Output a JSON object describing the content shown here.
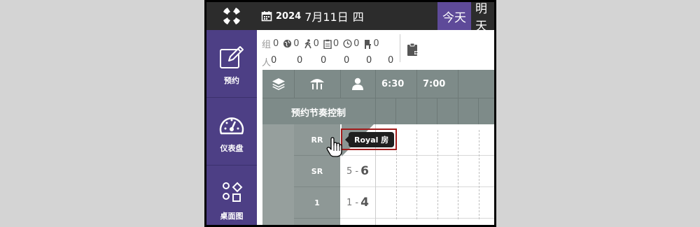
{
  "topbar": {
    "year": "2024",
    "month_day": "7月11日",
    "weekday": "四",
    "today_label": "今天",
    "tomorrow_label": "明天"
  },
  "sidebar": {
    "items": [
      {
        "label": "预约",
        "icon": "edit-icon"
      },
      {
        "label": "仪表盘",
        "icon": "dashboard-gauge-icon"
      },
      {
        "label": "桌面图",
        "icon": "shapes-icon"
      }
    ]
  },
  "stats": {
    "group_label": "组",
    "people_label": "人",
    "group_counts": [
      "0",
      "0",
      "0",
      "0",
      "0",
      "0"
    ],
    "people_counts": [
      "0",
      "0",
      "0",
      "0",
      "0",
      "0"
    ],
    "icons": [
      "globe-icon",
      "walking-person-icon",
      "clipboard-icon",
      "clock-icon",
      "table-chair-icon"
    ]
  },
  "grid": {
    "header_icons": [
      "layers-icon",
      "table-umbrella-icon",
      "person-icon"
    ],
    "times": [
      "6:30",
      "7:00"
    ],
    "pace_control_label": "预约节奏控制",
    "rows": [
      {
        "room_type": "RR",
        "capacity_min": "",
        "capacity_max": ""
      },
      {
        "room_type": "SR",
        "capacity_min": "5 -",
        "capacity_max": "6"
      },
      {
        "room_type": "1",
        "capacity_min": "1 -",
        "capacity_max": "4"
      }
    ]
  },
  "tooltip": {
    "text": "Royal 房"
  },
  "colors": {
    "sidebar": "#4d3f85",
    "today_highlight": "#5e4a99",
    "grid_header": "#7e8b89",
    "highlight_box": "#a11a1a"
  }
}
